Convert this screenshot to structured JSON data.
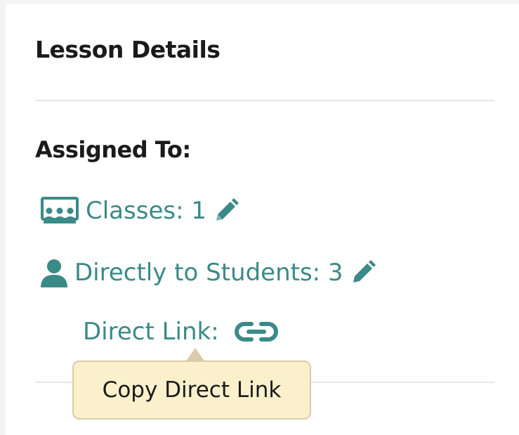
{
  "lesson": {
    "title": "Lesson Details",
    "assigned_heading": "Assigned To:",
    "classes_label": "Classes: 1",
    "students_label": "Directly to Students: 3",
    "direct_link_label": "Direct Link:"
  },
  "tooltip": {
    "text": "Copy Direct Link"
  },
  "colors": {
    "accent": "#3a8a87",
    "tooltip_bg": "#fbf0cc",
    "tooltip_border": "#d9ccaa",
    "divider": "#e6e6e6"
  },
  "icons": {
    "classes": "classroom-icon",
    "students": "user-icon",
    "edit": "pencil-icon",
    "link": "link-icon"
  }
}
